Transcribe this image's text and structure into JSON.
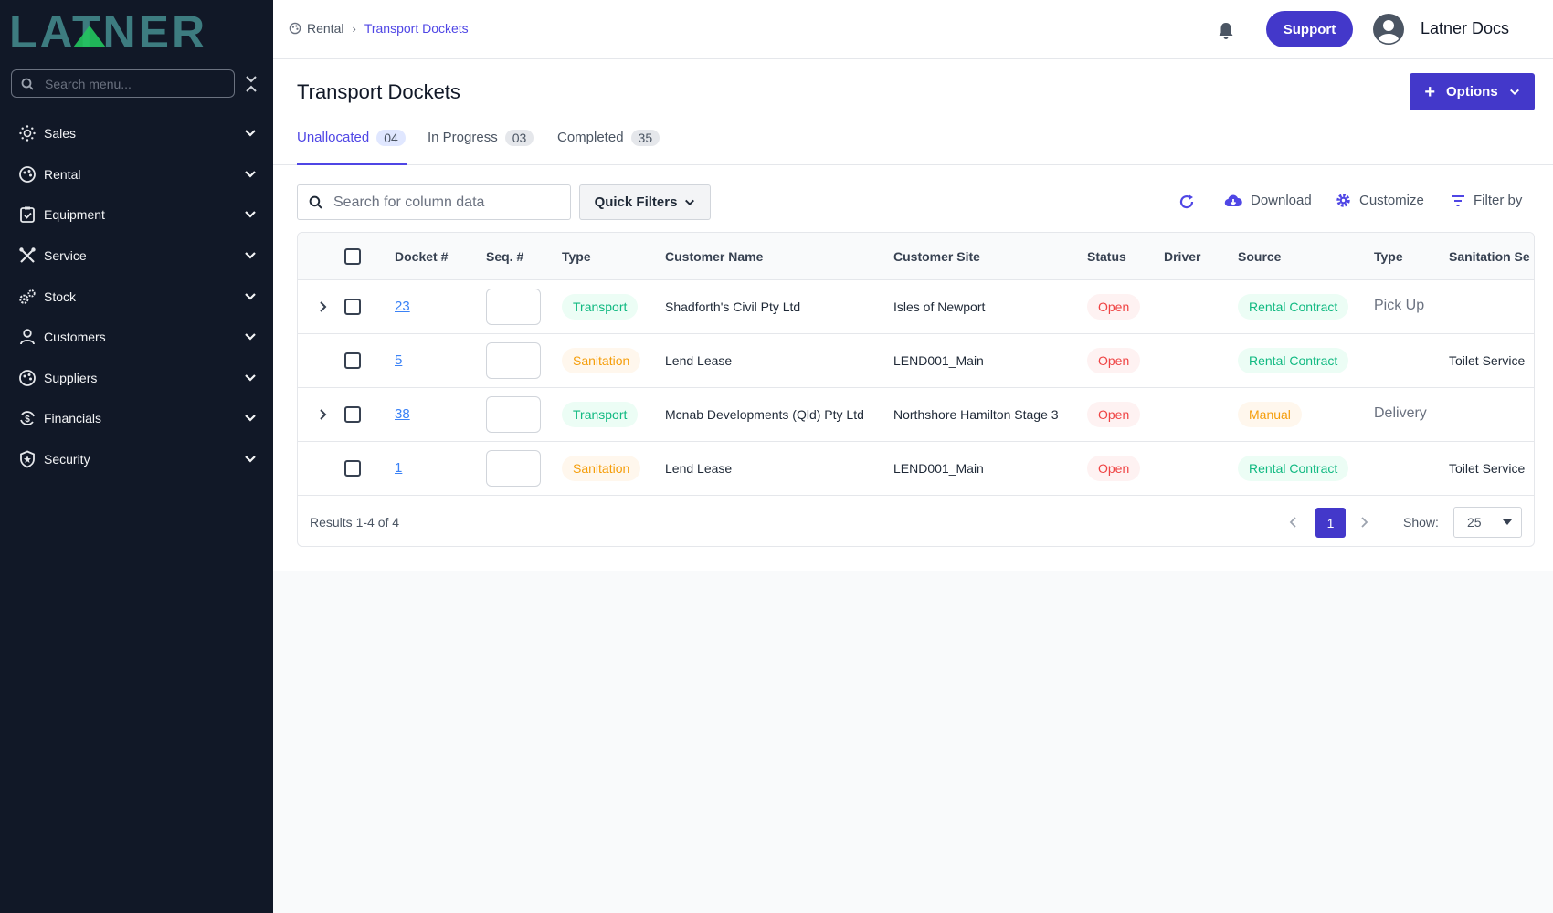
{
  "app": {
    "logo_text": "LATNER"
  },
  "sidebar": {
    "search_placeholder": "Search menu...",
    "items": [
      {
        "label": "Sales",
        "icon": "sun-dots-icon"
      },
      {
        "label": "Rental",
        "icon": "palette-icon"
      },
      {
        "label": "Equipment",
        "icon": "clipboard-check-icon"
      },
      {
        "label": "Service",
        "icon": "tools-icon"
      },
      {
        "label": "Stock",
        "icon": "cogs-icon"
      },
      {
        "label": "Customers",
        "icon": "user-icon"
      },
      {
        "label": "Suppliers",
        "icon": "palette-icon"
      },
      {
        "label": "Financials",
        "icon": "dollar-cycle-icon"
      },
      {
        "label": "Security",
        "icon": "shield-star-icon"
      }
    ]
  },
  "header": {
    "breadcrumb": [
      "Rental",
      "Transport Dockets"
    ],
    "support_label": "Support",
    "user_name": "Latner Docs"
  },
  "page": {
    "title": "Transport Dockets",
    "options_label": "Options",
    "tabs": [
      {
        "label": "Unallocated",
        "count": "04",
        "active": true
      },
      {
        "label": "In Progress",
        "count": "03",
        "active": false
      },
      {
        "label": "Completed",
        "count": "35",
        "active": false
      }
    ]
  },
  "toolbar": {
    "search_placeholder": "Search for column data",
    "quick_filters_label": "Quick Filters",
    "download_label": "Download",
    "customize_label": "Customize",
    "filter_label": "Filter by"
  },
  "table": {
    "headers": [
      "Docket #",
      "Seq. #",
      "Type",
      "Customer Name",
      "Customer Site",
      "Status",
      "Driver",
      "Source",
      "Type",
      "Sanitation Se"
    ],
    "rows": [
      {
        "expandable": true,
        "docket": "23",
        "type": "Transport",
        "type_color": "green",
        "customer": "Shadforth's Civil Pty Ltd",
        "site": "Isles of Newport",
        "status": "Open",
        "source": "Rental Contract",
        "source_color": "green",
        "type2": "Pick Up",
        "sanitation": ""
      },
      {
        "expandable": false,
        "docket": "5",
        "type": "Sanitation",
        "type_color": "orange",
        "customer": "Lend Lease",
        "site": "LEND001_Main",
        "status": "Open",
        "source": "Rental Contract",
        "source_color": "green",
        "type2": "",
        "sanitation": "Toilet Service"
      },
      {
        "expandable": true,
        "docket": "38",
        "type": "Transport",
        "type_color": "green",
        "customer": "Mcnab Developments (Qld) Pty Ltd",
        "site": "Northshore Hamilton Stage 3",
        "status": "Open",
        "source": "Manual",
        "source_color": "orange",
        "type2": "Delivery",
        "sanitation": ""
      },
      {
        "expandable": false,
        "docket": "1",
        "type": "Sanitation",
        "type_color": "orange",
        "customer": "Lend Lease",
        "site": "LEND001_Main",
        "status": "Open",
        "source": "Rental Contract",
        "source_color": "green",
        "type2": "",
        "sanitation": "Toilet Service"
      }
    ],
    "results_text": "Results 1-4 of 4",
    "current_page": "1",
    "show_label": "Show:",
    "page_size": "25"
  },
  "colors": {
    "accent": "#4338ca",
    "sidebar_bg": "#111827",
    "logo_teal": "#3d7c80",
    "logo_green": "#22c55e"
  }
}
